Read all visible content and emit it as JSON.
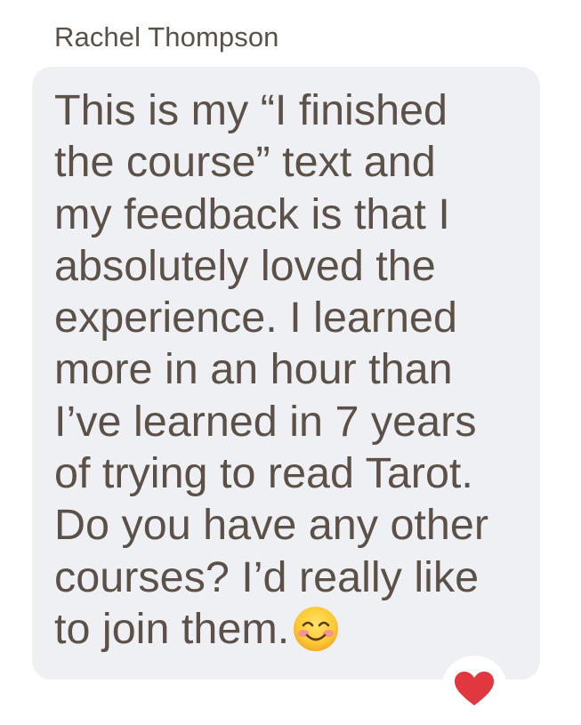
{
  "message": {
    "sender_name": "Rachel Thompson",
    "lines": [
      "This is my “I finished",
      "the course” text and",
      "my feedback is that I",
      "absolutely loved the",
      "experience. I learned",
      "more in an hour than",
      "I’ve learned in 7 years",
      "of trying to read Tarot.",
      "Do you have any other",
      "courses? I’d really like",
      "to join them."
    ],
    "emoji_icon": "smiling-face-with-smiling-eyes-icon",
    "bubble_color": "#eff0f4",
    "text_color": "#5c5148"
  },
  "reaction": {
    "icon": "heart-icon",
    "color": "#e0383e"
  }
}
